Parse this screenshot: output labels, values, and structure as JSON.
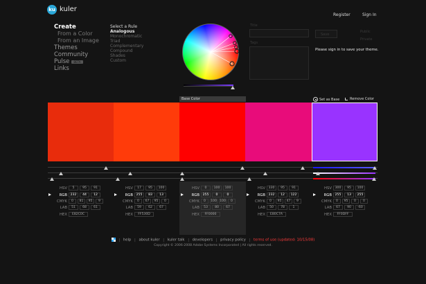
{
  "header": {
    "logo_badge": "ku",
    "logo_text": "kuler",
    "register": "Register",
    "sign_in": "Sign In"
  },
  "nav": {
    "create": "Create",
    "from_color": "From a Color",
    "from_image": "From an Image",
    "themes": "Themes",
    "community": "Community",
    "pulse": "Pulse",
    "pulse_badge": "BETA",
    "links": "Links"
  },
  "rules": {
    "title": "Select a Rule",
    "items": [
      "Analogous",
      "Monochromatic",
      "Triad",
      "Complementary",
      "Compound",
      "Shades",
      "Custom"
    ],
    "active_index": 0
  },
  "right_panel": {
    "title_label": "Title",
    "tags_label": "Tags",
    "public_label": "Public",
    "private_label": "Private",
    "save_label": "Save",
    "signin_message": "Please sign in to save your theme."
  },
  "swatches": {
    "base_label": "Base Color",
    "set_as_base": "Set as Base",
    "remove_color": "Remove Color",
    "colors": [
      "#E82C0C",
      "#FF3B0A",
      "#FF0000",
      "#E80C7A",
      "#9933FF"
    ]
  },
  "labels": {
    "hsv": "HSV",
    "rgb": "RGB",
    "cmyk": "CMYK",
    "lab": "LAB",
    "hex": "HEX"
  },
  "columns": [
    {
      "hsv": [
        "5",
        "95",
        "91"
      ],
      "rgb": [
        "232",
        "44",
        "12"
      ],
      "cmyk": [
        "0",
        "81",
        "95",
        "9"
      ],
      "lab": [
        "51",
        "68",
        "61"
      ],
      "hex": "E82C0C"
    },
    {
      "hsv": [
        "17",
        "95",
        "100"
      ],
      "rgb": [
        "255",
        "83",
        "13"
      ],
      "cmyk": [
        "0",
        "67",
        "95",
        "0"
      ],
      "lab": [
        "59",
        "62",
        "67"
      ],
      "hex": "FF530D"
    },
    {
      "hsv": [
        "0",
        "100",
        "100"
      ],
      "rgb": [
        "255",
        "0",
        "0"
      ],
      "cmyk": [
        "0",
        "100",
        "100",
        "0"
      ],
      "lab": [
        "53",
        "80",
        "67"
      ],
      "hex": "FF0000"
    },
    {
      "hsv": [
        "330",
        "95",
        "91"
      ],
      "rgb": [
        "232",
        "12",
        "122"
      ],
      "cmyk": [
        "0",
        "95",
        "47",
        "9"
      ],
      "lab": [
        "50",
        "78",
        "1"
      ],
      "hex": "E80C7A"
    },
    {
      "hsv": [
        "300",
        "95",
        "100"
      ],
      "rgb": [
        "255",
        "13",
        "255"
      ],
      "cmyk": [
        "0",
        "95",
        "0",
        "0"
      ],
      "lab": [
        "67",
        "90",
        "-60"
      ],
      "hex": "FF0DFF"
    }
  ],
  "footer": {
    "links": [
      "help",
      "about kuler",
      "kuler talk",
      "developers",
      "privacy policy"
    ],
    "terms": "terms of use (updated: 10/15/08)",
    "copyright": "Copyright © 2006-2008 Adobe Systems Incorporated | All rights reserved."
  },
  "accent_colors": {
    "logo": "#2aa7d8",
    "terms": "#ff3c3c"
  }
}
